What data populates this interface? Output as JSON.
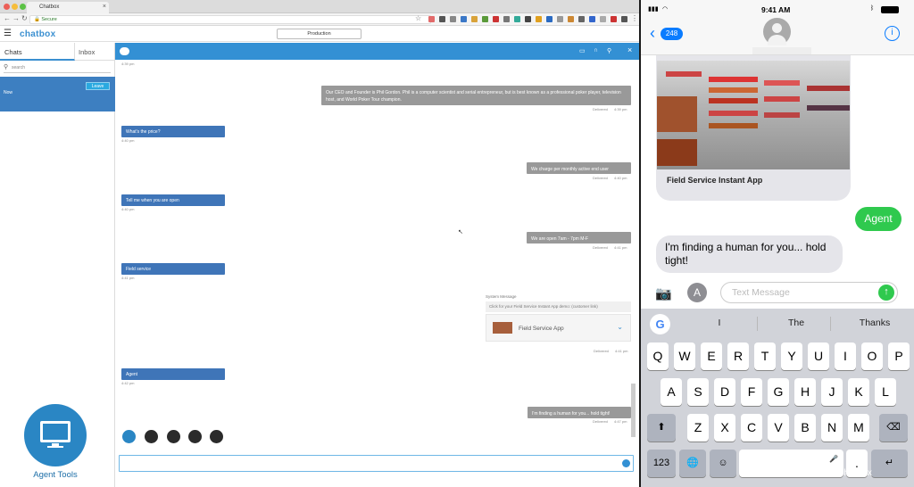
{
  "browser": {
    "tab_title": "Chatbox",
    "url": "Secure",
    "app_logo": "chatbox",
    "environment": "Production"
  },
  "sidebar": {
    "tab_chats": "Chats",
    "tab_inbox": "Inbox",
    "search_placeholder": "search",
    "chat_item_label": "Now",
    "leave_label": "Leave",
    "agent_tools_label": "Agent Tools"
  },
  "chat": {
    "messages": [
      {
        "side": "right",
        "text": "Our CEO and Founder is Phil Gordon.  Phil is a computer scientist and serial entrepreneur, but is best known as a professional poker player, television host, and World Poker Tour champion.",
        "status": "Delivered",
        "time": "4:39 pm"
      },
      {
        "side": "left",
        "text": "What's the price?",
        "time": "4:40 pm"
      },
      {
        "side": "right",
        "text": "We charge per monthly active end user",
        "status": "Delivered",
        "time": "4:40 pm"
      },
      {
        "side": "left",
        "text": "Tell me when you are open",
        "time": "4:40 pm"
      },
      {
        "side": "right",
        "text": "We are open 7am - 7pm M-F",
        "status": "Delivered",
        "time": "4:41 pm"
      },
      {
        "side": "left",
        "text": "Field service",
        "time": "4:41 pm"
      },
      {
        "side": "left",
        "text": "Agent",
        "time": "4:42 pm"
      },
      {
        "side": "right",
        "text": "I'm finding a human for you... hold tight!",
        "status": "Delivered",
        "time": "4:47 pm"
      }
    ],
    "top_time": "4:39 pm",
    "system_label": "System Message",
    "system_text": "Click for your Field Service Instant App demo: (customer link)",
    "service_card": "Field Service App",
    "service_status": "Delivered",
    "service_time": "4:41 pm"
  },
  "phone": {
    "time": "9:41 AM",
    "back_count": "248",
    "card_title": "Field Service Instant App",
    "agent_bubble": "Agent",
    "bot_message": "I'm finding a human for you... hold tight!",
    "input_placeholder": "Text Message",
    "suggestions": [
      "I",
      "The",
      "Thanks"
    ],
    "row1": [
      "Q",
      "W",
      "E",
      "R",
      "T",
      "Y",
      "U",
      "I",
      "O",
      "P"
    ],
    "row2": [
      "A",
      "S",
      "D",
      "F",
      "G",
      "H",
      "J",
      "K",
      "L"
    ],
    "row3": [
      "Z",
      "X",
      "C",
      "V",
      "B",
      "N",
      "M"
    ],
    "num_key": "123",
    "return_key": "↵"
  },
  "watermark": "chatbox"
}
